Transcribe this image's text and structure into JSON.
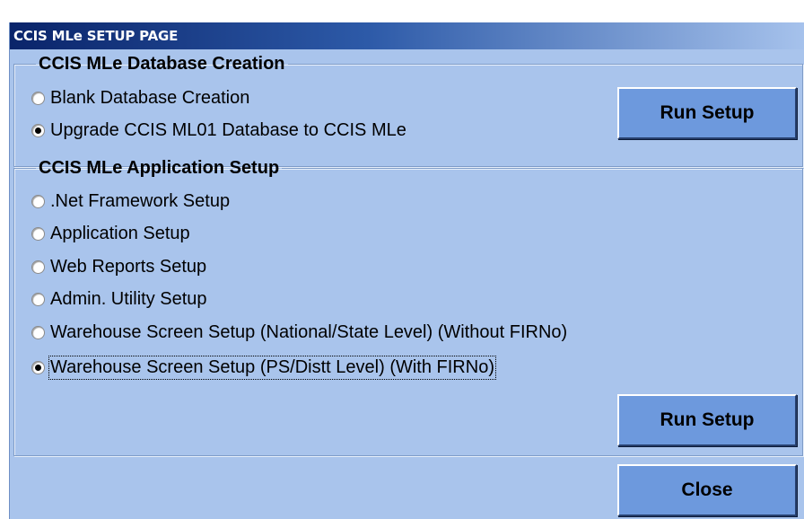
{
  "window": {
    "title": "CCIS MLe SETUP PAGE"
  },
  "database_group": {
    "title": "CCIS MLe Database Creation",
    "options": [
      {
        "label": "Blank Database Creation",
        "checked": false
      },
      {
        "label": "Upgrade CCIS ML01 Database to CCIS MLe",
        "checked": true
      }
    ],
    "run_button_label": "Run Setup"
  },
  "application_group": {
    "title": "CCIS MLe Application Setup",
    "options": [
      {
        "label": ".Net Framework Setup",
        "checked": false
      },
      {
        "label": "Application Setup",
        "checked": false
      },
      {
        "label": "Web Reports Setup",
        "checked": false
      },
      {
        "label": "Admin. Utility Setup",
        "checked": false
      },
      {
        "label": "Warehouse Screen Setup (National/State Level) (Without FIRNo)",
        "checked": false
      },
      {
        "label": "Warehouse Screen Setup (PS/Distt Level) (With FIRNo)",
        "checked": true
      }
    ],
    "run_button_label": "Run Setup"
  },
  "close_button_label": "Close",
  "colors": {
    "window_background": "#a9c4ec",
    "title_gradient_start": "#0a246a",
    "button_face": "#6d99dd"
  }
}
